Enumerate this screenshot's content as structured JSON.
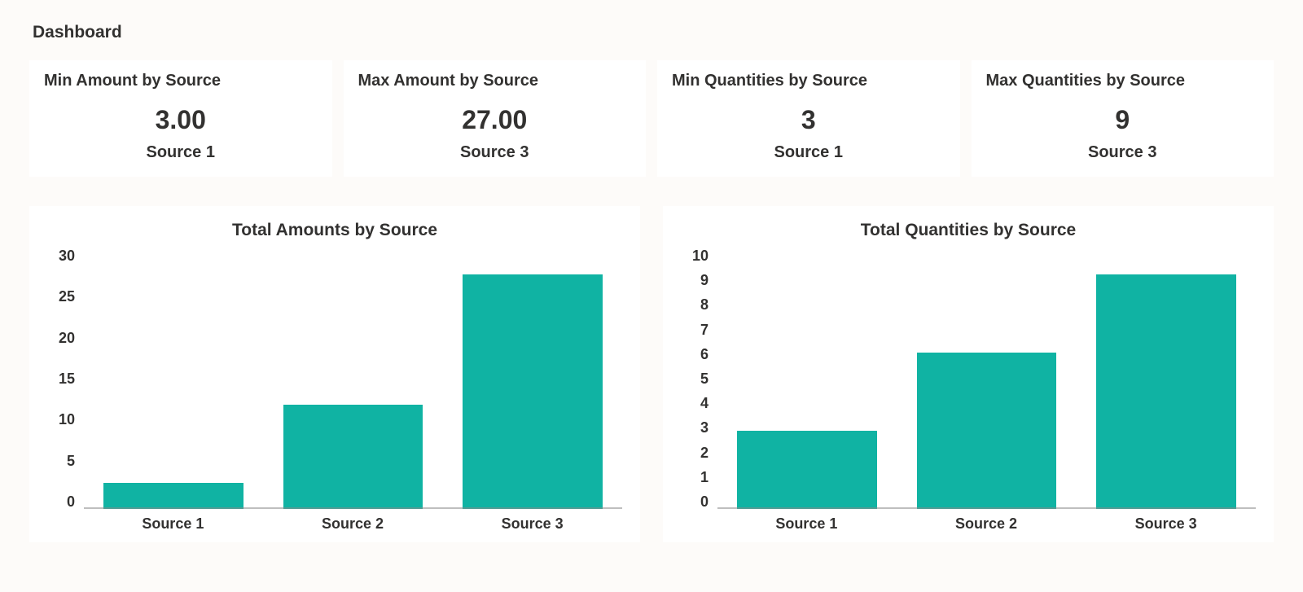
{
  "page_title": "Dashboard",
  "cards": [
    {
      "title": "Min Amount by Source",
      "value": "3.00",
      "sub": "Source 1"
    },
    {
      "title": "Max Amount by Source",
      "value": "27.00",
      "sub": "Source 3"
    },
    {
      "title": "Min Quantities by Source",
      "value": "3",
      "sub": "Source 1"
    },
    {
      "title": "Max Quantities by Source",
      "value": "9",
      "sub": "Source 3"
    }
  ],
  "charts": [
    {
      "title": "Total Amounts by Source",
      "categories": [
        "Source 1",
        "Source 2",
        "Source 3"
      ],
      "values": [
        3,
        12,
        27
      ],
      "ylim": [
        0,
        30
      ],
      "ystep": 5
    },
    {
      "title": "Total Quantities by Source",
      "categories": [
        "Source 1",
        "Source 2",
        "Source 3"
      ],
      "values": [
        3,
        6,
        9
      ],
      "ylim": [
        0,
        10
      ],
      "ystep": 1
    }
  ],
  "chart_data": [
    {
      "type": "bar",
      "title": "Total Amounts by Source",
      "categories": [
        "Source 1",
        "Source 2",
        "Source 3"
      ],
      "values": [
        3,
        12,
        27
      ],
      "xlabel": "",
      "ylabel": "",
      "ylim": [
        0,
        30
      ],
      "ytick_step": 5
    },
    {
      "type": "bar",
      "title": "Total Quantities by Source",
      "categories": [
        "Source 1",
        "Source 2",
        "Source 3"
      ],
      "values": [
        3,
        6,
        9
      ],
      "xlabel": "",
      "ylabel": "",
      "ylim": [
        0,
        10
      ],
      "ytick_step": 1
    }
  ],
  "colors": {
    "bar": "#10b3a3",
    "text": "#323130",
    "page_bg": "#fdfbf9",
    "card_bg": "#ffffff"
  }
}
